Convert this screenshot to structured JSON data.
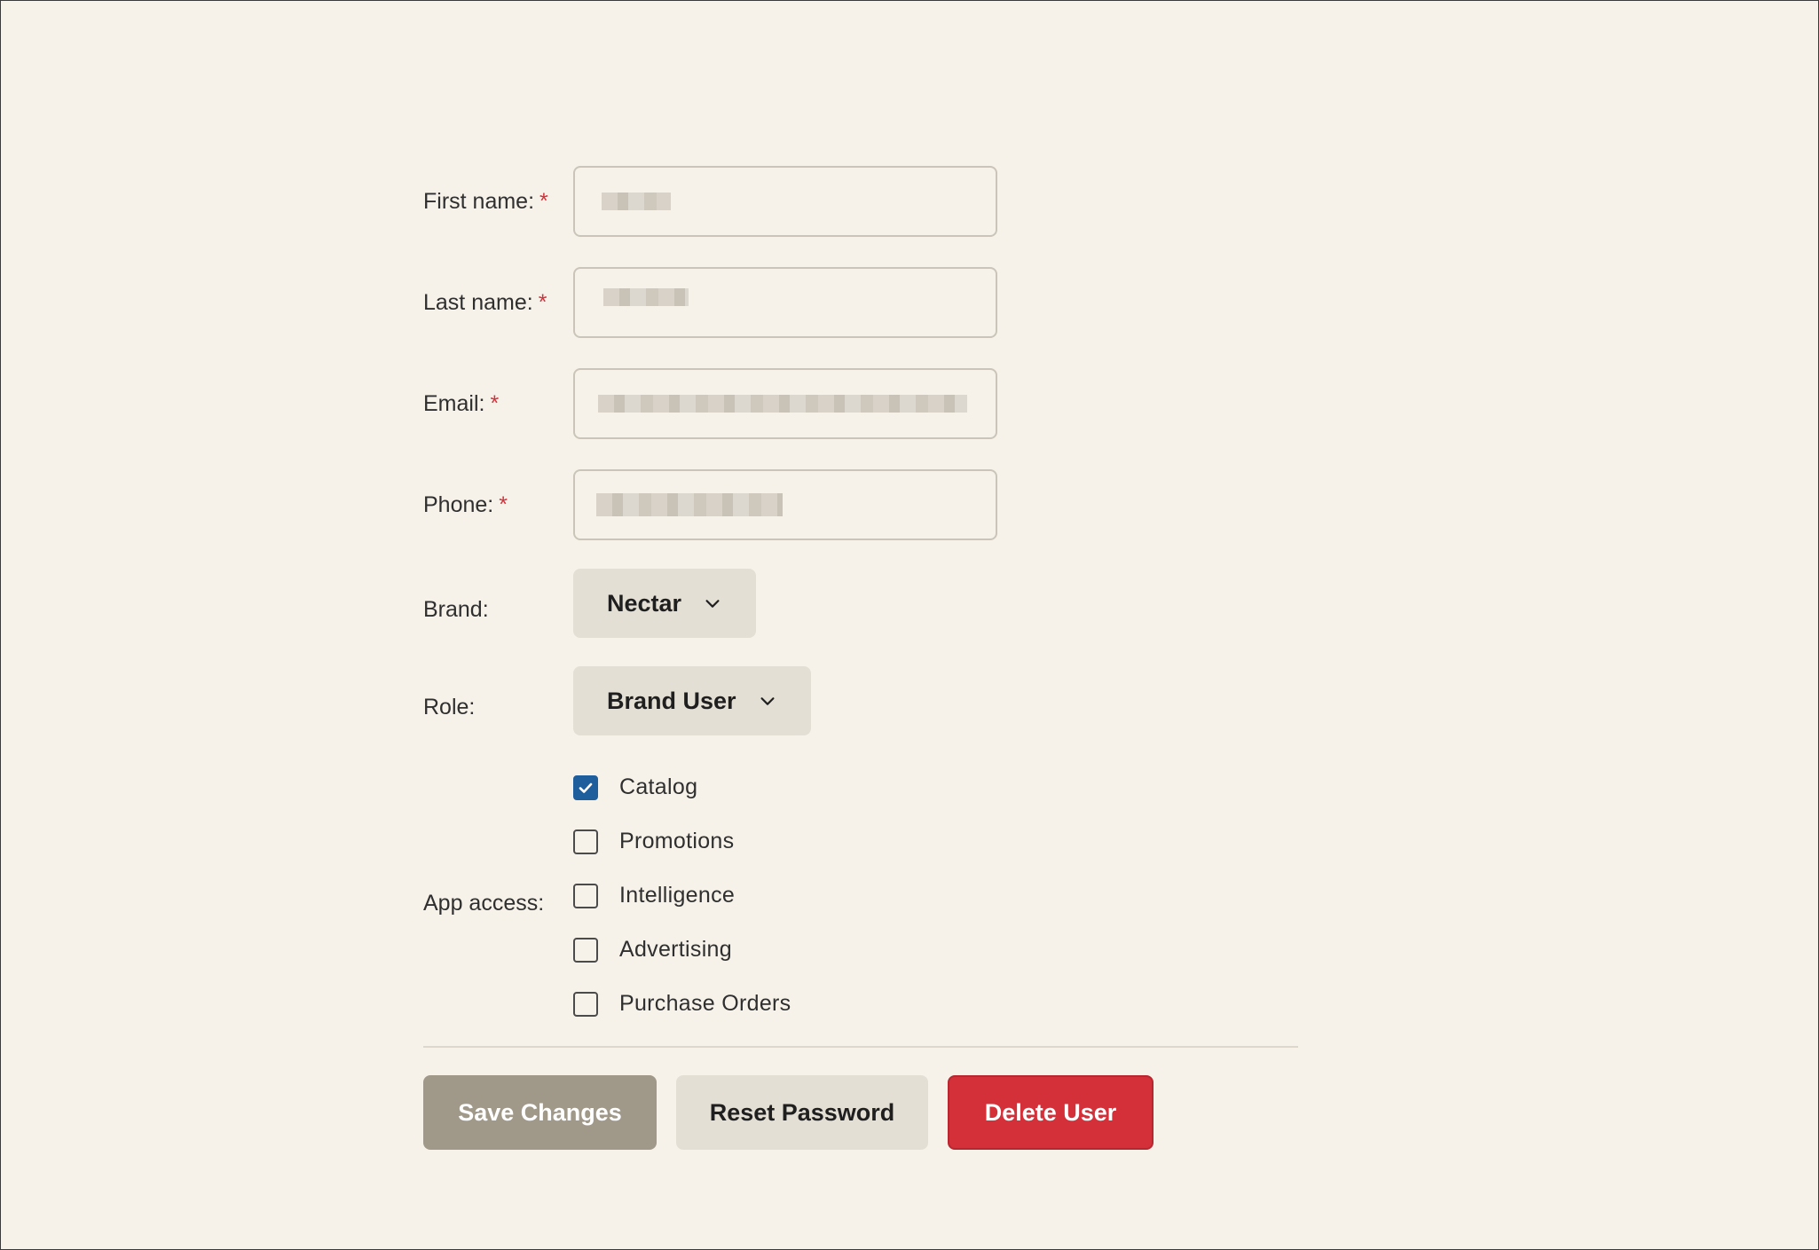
{
  "form": {
    "first_name": {
      "label": "First name:",
      "required_mark": "*",
      "value": ""
    },
    "last_name": {
      "label": "Last name:",
      "required_mark": "*",
      "value": ""
    },
    "email": {
      "label": "Email:",
      "required_mark": "*",
      "value": ""
    },
    "phone": {
      "label": "Phone:",
      "required_mark": "*",
      "value": ""
    },
    "brand": {
      "label": "Brand:",
      "selected": "Nectar"
    },
    "role": {
      "label": "Role:",
      "selected": "Brand User"
    },
    "app_access": {
      "label": "App access:",
      "options": [
        {
          "label": "Catalog",
          "checked": true
        },
        {
          "label": "Promotions",
          "checked": false
        },
        {
          "label": "Intelligence",
          "checked": false
        },
        {
          "label": "Advertising",
          "checked": false
        },
        {
          "label": "Purchase Orders",
          "checked": false
        }
      ]
    }
  },
  "actions": {
    "save_label": "Save Changes",
    "reset_label": "Reset Password",
    "delete_label": "Delete User"
  },
  "colors": {
    "background": "#f6f2ea",
    "required": "#d6303a",
    "checkbox_checked": "#1f5e9c",
    "save_button": "#a09889",
    "delete_button": "#d3303a"
  },
  "icons": {
    "dropdown": "chevron-down-icon",
    "check": "check-icon"
  }
}
